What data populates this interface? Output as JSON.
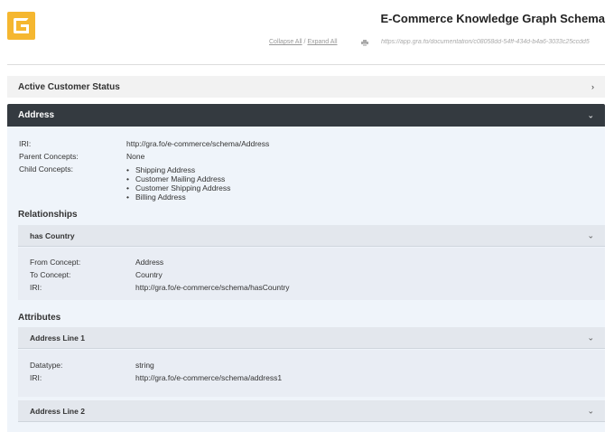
{
  "header": {
    "title": "E-Commerce Knowledge Graph Schema",
    "collapse_all": "Collapse All",
    "separator": "/",
    "expand_all": "Expand All",
    "url": "https://app.gra.fo/documentation/c08058dd-54ff-434d-b4a6-3033c25ccdd5"
  },
  "panels": {
    "active_customer_status": {
      "label": "Active Customer Status",
      "chevron": "›"
    },
    "address": {
      "label": "Address",
      "chevron": "⌄"
    }
  },
  "address": {
    "iri_label": "IRI:",
    "iri_value": "http://gra.fo/e-commerce/schema/Address",
    "parents_label": "Parent Concepts:",
    "parents_value": "None",
    "children_label": "Child Concepts:",
    "children": [
      "Shipping Address",
      "Customer Mailing Address",
      "Customer Shipping Address",
      "Billing Address"
    ],
    "relationships_title": "Relationships",
    "attributes_title": "Attributes"
  },
  "relationships": [
    {
      "name": "has Country",
      "from_label": "From Concept:",
      "from_value": "Address",
      "to_label": "To Concept:",
      "to_value": "Country",
      "iri_label": "IRI:",
      "iri_value": "http://gra.fo/e-commerce/schema/hasCountry"
    }
  ],
  "attributes": [
    {
      "name": "Address Line 1",
      "datatype_label": "Datatype:",
      "datatype_value": "string",
      "iri_label": "IRI:",
      "iri_value": "http://gra.fo/e-commerce/schema/address1"
    },
    {
      "name": "Address Line 2"
    }
  ],
  "icons": {
    "logo": "grafo-logo",
    "print": "print-icon",
    "chevron": "chevron-down-icon"
  },
  "colors": {
    "brand": "#f5b730",
    "header_dark": "#343a40",
    "body_bg": "#eff4fa"
  }
}
